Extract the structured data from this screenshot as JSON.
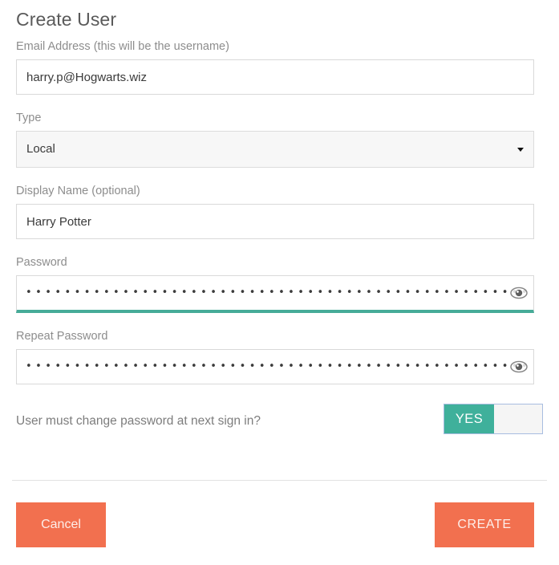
{
  "dialog": {
    "title": "Create User"
  },
  "fields": {
    "email": {
      "label": "Email Address (this will be the username)",
      "value": "harry.p@Hogwarts.wiz",
      "placeholder": ""
    },
    "type": {
      "label": "Type",
      "value": "Local",
      "caret_icon": "chevron-down-icon"
    },
    "display_name": {
      "label": "Display Name (optional)",
      "value": "Harry Potter",
      "placeholder": ""
    },
    "password": {
      "label": "Password",
      "masked_value": "••••••••••••••••••••••••••••••••••••••••••••••••••••••••••••••",
      "reveal_icon": "eye-icon",
      "focused": true
    },
    "repeat_password": {
      "label": "Repeat Password",
      "masked_value": "••••••••••••••••••••••••••••••••••••••••••••••••••••••••••••••",
      "reveal_icon": "eye-icon",
      "focused": false
    }
  },
  "toggle": {
    "question": "User must change password at next sign in?",
    "state_label": "YES"
  },
  "footer": {
    "cancel_label": "Cancel",
    "create_label": "CREATE"
  },
  "colors": {
    "accent_teal": "#3fb09b",
    "focus_underline": "#46ab98",
    "button_coral": "#f2704f",
    "label_gray": "#8d8d8d",
    "title_gray": "#5a5a5a",
    "input_border": "#d9d9d9",
    "select_background": "#f7f7f7",
    "toggle_border": "#a8bde0"
  }
}
